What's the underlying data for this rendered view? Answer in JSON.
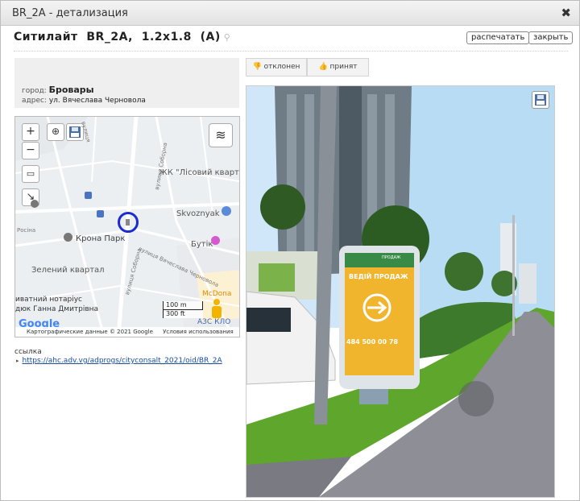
{
  "window": {
    "title": "BR_2A - детализация"
  },
  "header": {
    "title": "Ситилайт  BR_2A,  1.2x1.8  (A)",
    "print_label": "распечатать",
    "close_label": "закрыть"
  },
  "info": {
    "city_label": "город:",
    "city_value": "Бровары",
    "address_label": "адрес:",
    "address_value": "ул. Вячеслава Черновола"
  },
  "map": {
    "zoom_in": "+",
    "zoom_out": "−",
    "places": [
      "ЖК \"Лісовий кварт",
      "Skvoznyak",
      "Крона Парк",
      "Бутік",
      "Зелений квартал",
      "иватний нотаріус",
      "дюк Ганна Дмитрівна",
      "McDona",
      "АЗС КЛО"
    ],
    "streets": [
      "вулиця",
      "Росіна",
      "вулиця Соборна",
      "вулиця Вячеслава Черновола",
      "вулиця Соборна"
    ],
    "scale_m": "100 m",
    "scale_ft": "300 ft",
    "copyright": "Картографические данные © 2021 Google",
    "terms": "Условия использования",
    "google": "Google"
  },
  "link": {
    "label": "ссылка",
    "url": "https://ahc.adv.vg/adprogs/cityconsalt_2021/oid/BR_2A"
  },
  "vote": {
    "reject_label": "отклонен",
    "accept_label": "принят"
  },
  "photo": {
    "billboard_line1": "ВЕДІЙ ПРОДАЖ",
    "billboard_phone": "484 500 00 78",
    "billboard_small": "ПРОДАЖ"
  },
  "colors": {
    "map_marker": "#1a2bd0",
    "link": "#1a4ea3",
    "sky": "#cfe7f8",
    "grass": "#5ea72c",
    "billboard": "#f0b52d"
  }
}
